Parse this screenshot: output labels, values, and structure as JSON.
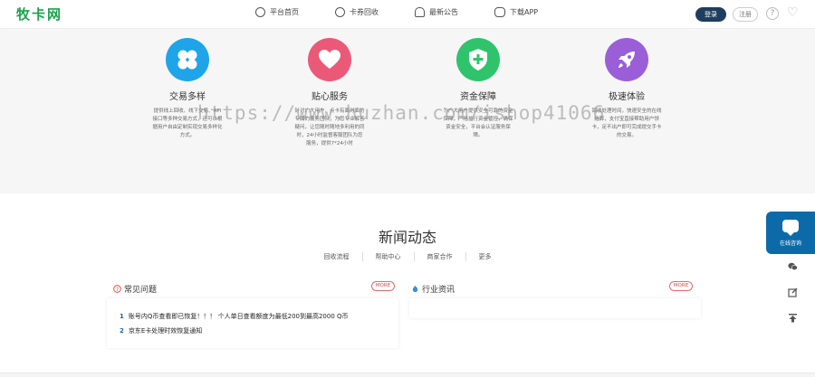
{
  "header": {
    "logo": "牧卡网",
    "nav": [
      {
        "label": "平台首页",
        "icon": "home-icon"
      },
      {
        "label": "卡券回收",
        "icon": "coupon-icon"
      },
      {
        "label": "最新公告",
        "icon": "bell-icon"
      },
      {
        "label": "下载APP",
        "icon": "app-icon"
      }
    ],
    "login_label": "登录",
    "register_label": "注册",
    "help_glyph": "?",
    "heart_glyph": "♡"
  },
  "features": [
    {
      "title": "交易多样",
      "desc": "提供线上回收、线下交易、API接口等多种交易方式，还可以根据用户自由定制实现交易多样化方式。",
      "color": "#1ea5e9",
      "icon": "clover-icon"
    },
    {
      "title": "贴心服务",
      "desc": "针对广大用户，点卡有面对面的专属的服务团队，为您专业解答疑问，让您随时随地多利用的同时，24小时监督客服团队为您服务，提供7*24小时",
      "color": "#ea5a78",
      "icon": "heart-icon"
    },
    {
      "title": "资金保障",
      "desc": "为广大用户提供安全可靠的资金保障，严格执行资金管控，确保资金安全，平台会认证服务保障。",
      "color": "#2fc46b",
      "icon": "shield-plus-icon"
    },
    {
      "title": "极速体验",
      "desc": "回收处理时间，快速安全的在线结算，支付宝直接帮助用户领卡，足不出户即可完成提交手卡的交易。",
      "color": "#9a5fd8",
      "icon": "rocket-icon"
    }
  ],
  "watermark": "https://www.huzhan.com/ishop41066",
  "news": {
    "title": "新闻动态",
    "tabs": [
      "回收流程",
      "帮助中心",
      "商家合作",
      "更多"
    ],
    "faq": {
      "title": "常见问题",
      "more": "MORE",
      "items": [
        {
          "num": "1",
          "text": "账号内Q币查看即已恢复！！！ 个人单日查看额度为最低200到最高2000 Q币"
        },
        {
          "num": "2",
          "text": "京东E卡处理时效恢复通知"
        }
      ]
    },
    "industry": {
      "title": "行业资讯",
      "more": "MORE"
    }
  },
  "side": {
    "chat_label": "在线咨询"
  }
}
